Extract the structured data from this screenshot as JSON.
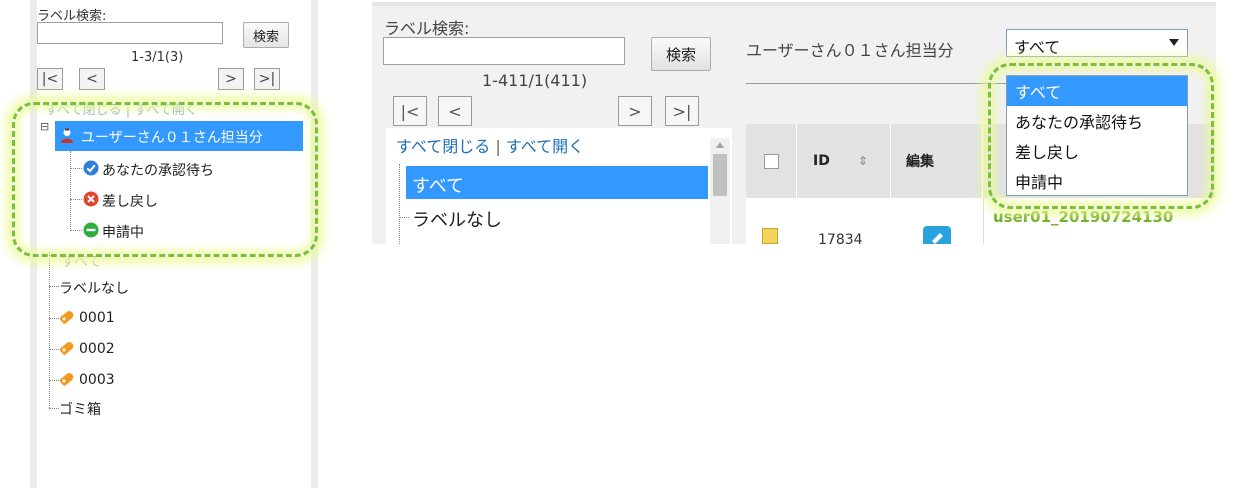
{
  "left": {
    "search_label": "ラベル検索:",
    "search_value": "",
    "search_button": "検索",
    "page_info": "1-3/1(3)",
    "pager": {
      "first": "|<",
      "prev": "<",
      "next": ">",
      "last": ">|"
    },
    "collapse_all": "すべて閉じる",
    "separator": "|",
    "expand_all": "すべて開く",
    "tree_toggle": "⊟",
    "root_label": "ユーザーさん０１さん担当分",
    "children": [
      {
        "label": "あなたの承認待ち",
        "icon": "check-icon",
        "color": "#2f7fd7"
      },
      {
        "label": "差し戻し",
        "icon": "error-icon",
        "color": "#e0452e"
      },
      {
        "label": "申請中",
        "icon": "pending-icon",
        "color": "#2fae3f"
      }
    ],
    "tree_items": [
      {
        "label": "すべて"
      },
      {
        "label": "ラベルなし"
      },
      {
        "label": "0001",
        "icon": "tag-icon"
      },
      {
        "label": "0002",
        "icon": "tag-icon"
      },
      {
        "label": "0003",
        "icon": "tag-icon"
      },
      {
        "label": "ゴミ箱"
      }
    ],
    "highlight_color": "#7cc03a"
  },
  "right": {
    "search_label": "ラベル検索:",
    "search_value": "",
    "search_button": "検索",
    "page_info": "1-411/1(411)",
    "pager": {
      "first": "|<",
      "prev": "<",
      "next": ">",
      "last": ">|"
    },
    "collapse_all": "すべて閉じる",
    "separator": "|",
    "expand_all": "すべて開く",
    "tree_items": [
      {
        "label": "すべて",
        "selected": true
      },
      {
        "label": "ラベルなし"
      }
    ],
    "filter_label": "ユーザーさん０１さん担当分",
    "filter_selected": "すべて",
    "filter_options": [
      "すべて",
      "あなたの承認待ち",
      "差し戻し",
      "申請中"
    ],
    "table": {
      "headers": [
        "ID",
        "編集"
      ],
      "sort_icon": "⇕",
      "row": {
        "id": "17834",
        "link_fragment": "user01_20190724130"
      }
    },
    "accent": "#3399ff"
  }
}
